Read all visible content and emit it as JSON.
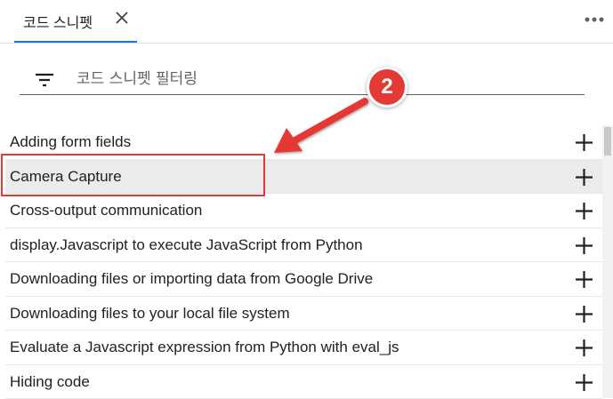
{
  "panel": {
    "tab_label": "코드 스니펫",
    "close_icon": "close-icon",
    "menu_icon": "more-options-icon"
  },
  "filter": {
    "icon": "filter-list-icon",
    "placeholder": "코드 스니펫 필터링",
    "value": ""
  },
  "snippets": [
    {
      "label": "Adding form fields",
      "action_icon": "add-icon"
    },
    {
      "label": "Camera Capture",
      "action_icon": "add-icon"
    },
    {
      "label": "Cross-output communication",
      "action_icon": "add-icon"
    },
    {
      "label": "display.Javascript to execute JavaScript from Python",
      "action_icon": "add-icon"
    },
    {
      "label": "Downloading files or importing data from Google Drive",
      "action_icon": "add-icon"
    },
    {
      "label": "Downloading files to your local file system",
      "action_icon": "add-icon"
    },
    {
      "label": "Evaluate a Javascript expression from Python with eval_js",
      "action_icon": "add-icon"
    },
    {
      "label": "Hiding code",
      "action_icon": "add-icon"
    }
  ],
  "annotation": {
    "step_number": "2",
    "color": "#e53935"
  },
  "colors": {
    "tab_accent": "#1a73e8",
    "hover_row": "#ebebeb"
  }
}
